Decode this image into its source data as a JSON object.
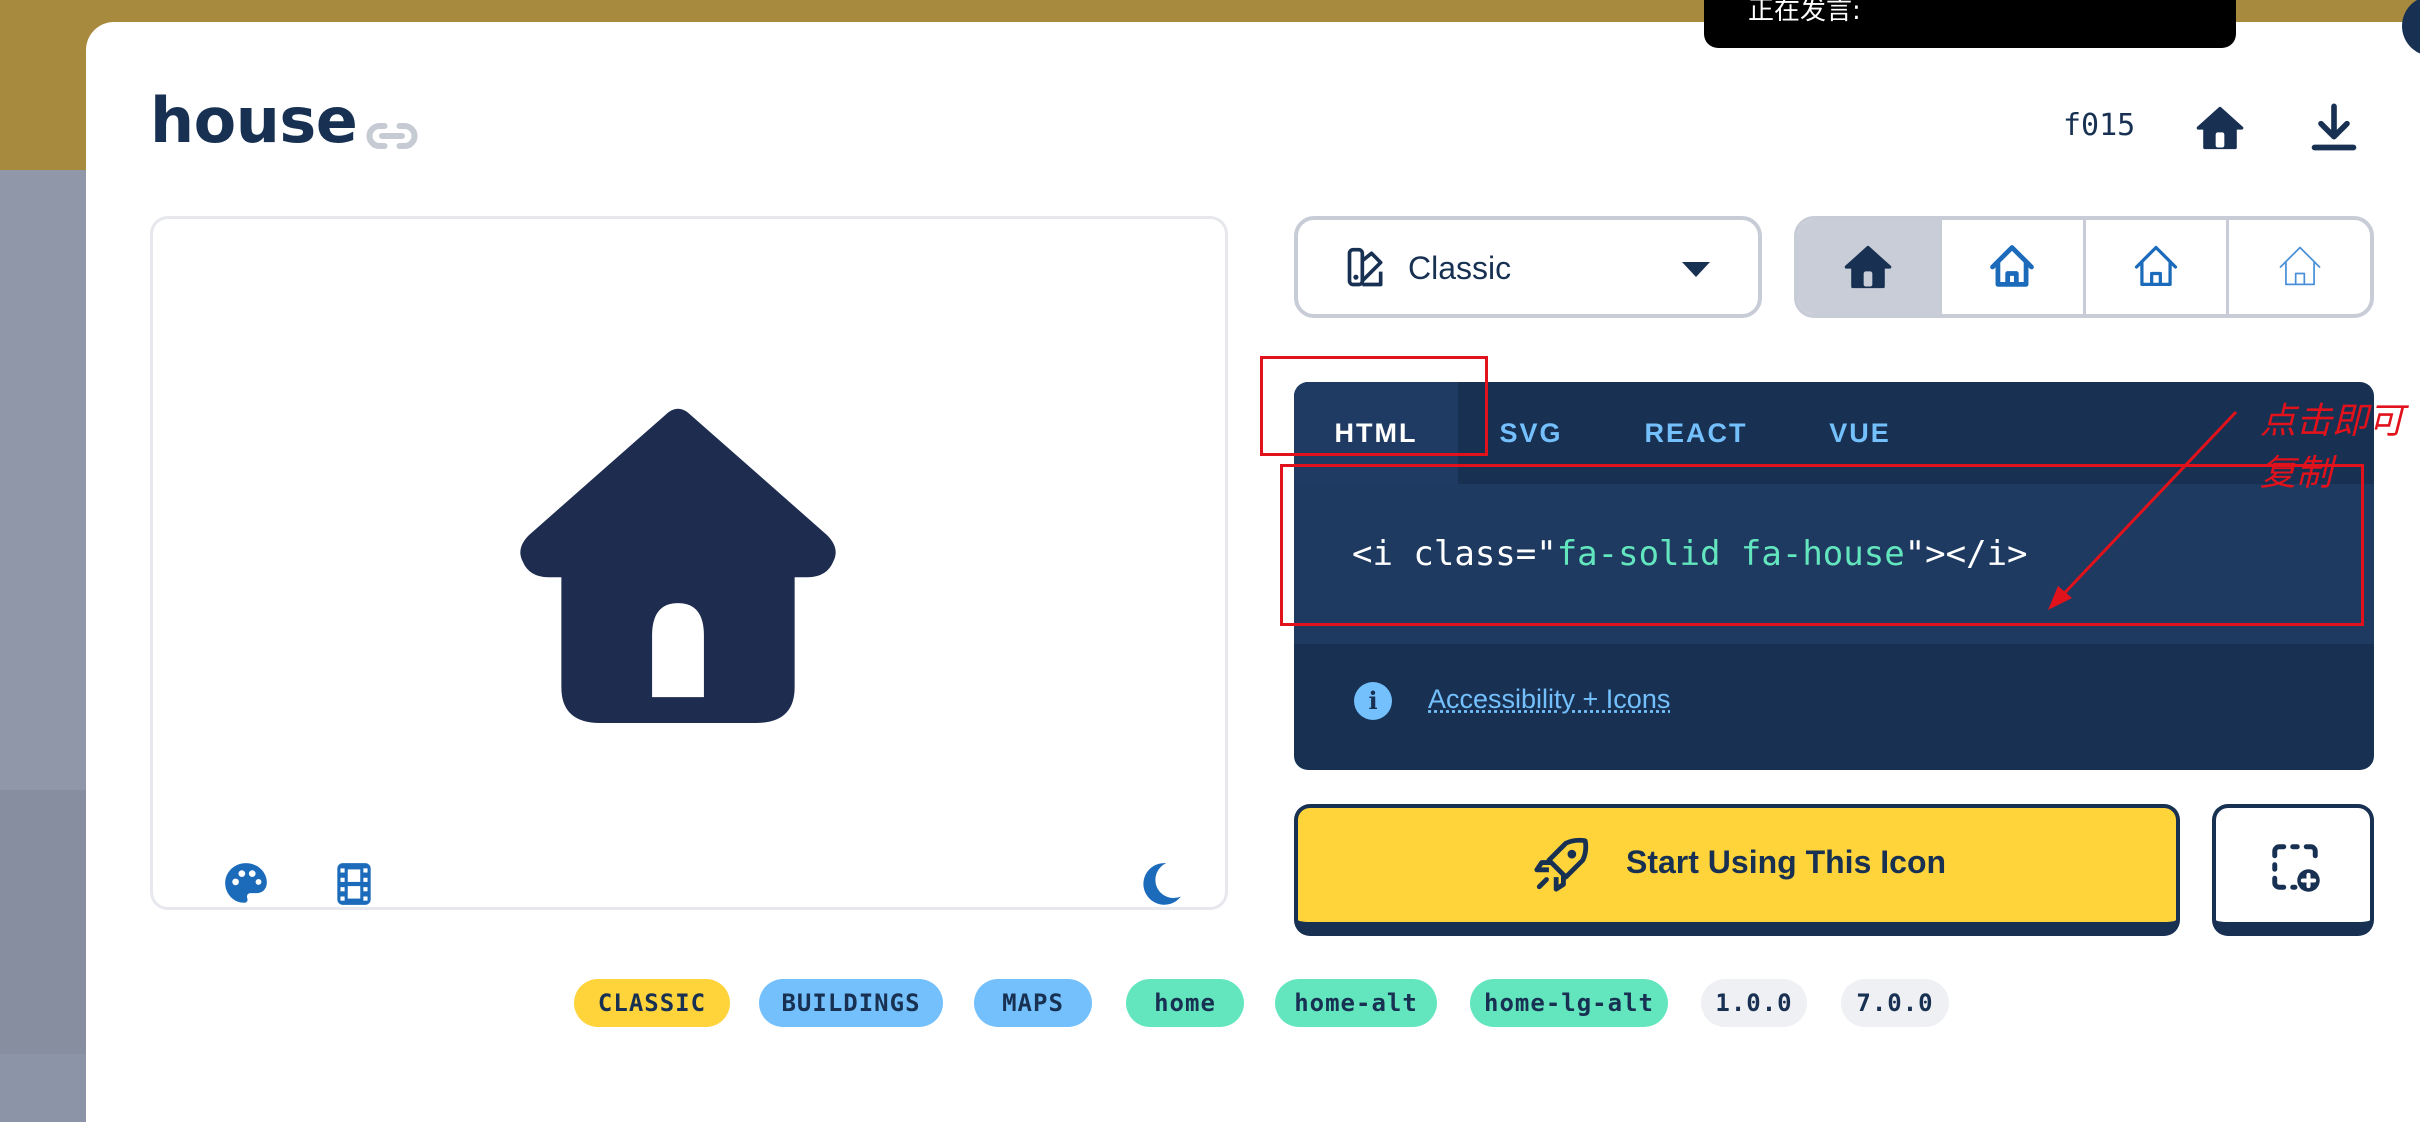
{
  "icon": {
    "name": "house",
    "unicode": "f015"
  },
  "style_select": {
    "selected": "Classic"
  },
  "code_panel": {
    "tabs": [
      "HTML",
      "SVG",
      "REACT",
      "VUE"
    ],
    "active_tab": "HTML",
    "code": {
      "open": "<i class=\"",
      "value": "fa-solid fa-house",
      "close": "\"></i>"
    },
    "accessibility_link": "Accessibility + Icons"
  },
  "actions": {
    "start_label": "Start Using This Icon"
  },
  "tags": [
    "CLASSIC",
    "BUILDINGS",
    "MAPS",
    "home",
    "home-alt",
    "home-lg-alt",
    "1.0.0",
    "7.0.0"
  ],
  "annotation": {
    "text": "点击即可复制"
  },
  "toast": {
    "text": "正在发言:"
  },
  "colors": {
    "navy": "#183153",
    "blue": "#1c6bba",
    "yellow": "#ffd43b",
    "light_blue": "#74c0fc",
    "teal": "#63e6be",
    "annotation_red": "#e1121b"
  }
}
